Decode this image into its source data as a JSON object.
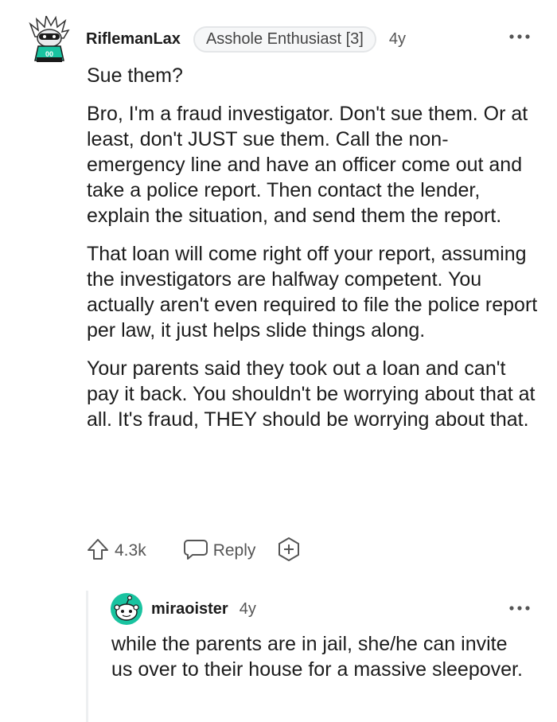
{
  "comment": {
    "username": "RiflemanLax",
    "flair": "Asshole Enthusiast [3]",
    "age": "4y",
    "avatar": {
      "icon": "snoo-avatar-icon",
      "jersey_text": "00"
    },
    "paragraphs": [
      "Sue them?",
      "Bro, I'm a fraud investigator. Don't sue them. Or at least, don't JUST sue them. Call the non-emergency line and have an officer come out and take a police report. Then contact the lender, explain the situation, and send them the report.",
      "That loan will come right off your report, assuming the investigators are halfway competent. You actually aren't even required to file the police report per law, it just helps slide things along.",
      "Your parents said they took out a loan and can't pay it back. You shouldn't be worrying about that at all. It's fraud, THEY should be worrying about that."
    ],
    "actions": {
      "upvote_count": "4.3k",
      "reply_label": "Reply"
    }
  },
  "reply": {
    "username": "miraoister",
    "age": "4y",
    "text": "while the parents are in jail, she/he can invite us over to their house for a massive sleepover."
  },
  "colors": {
    "text": "#1c1c1c",
    "meta": "#555555",
    "flair_border": "#e4e6e8",
    "avatar_accent": "#19c3a0"
  }
}
